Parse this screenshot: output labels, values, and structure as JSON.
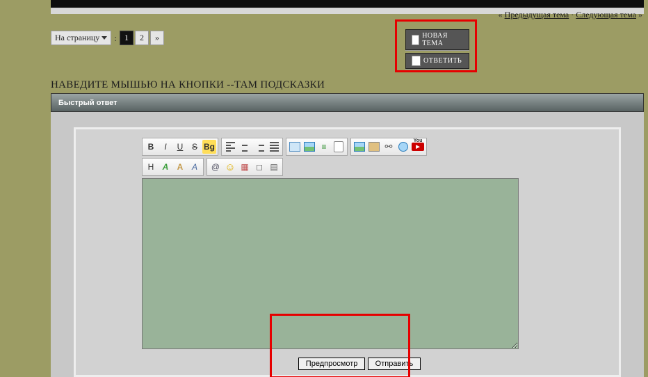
{
  "nav": {
    "prev_prefix": "«",
    "prev_link": "Предыдущая тема",
    "sep": "·",
    "next_link": "Следующая тема",
    "next_suffix": "»"
  },
  "pagination": {
    "label": "На страницу",
    "colon": ":",
    "current": "1",
    "page2": "2",
    "next": "»"
  },
  "actions": {
    "new_topic": "НОВАЯ ТЕМА",
    "reply": "ОТВЕТИТЬ"
  },
  "heading": "НАВЕДИТЕ МЫШЬЮ НА КНОПКИ --ТАМ ПОДСКАЗКИ",
  "quick_reply_title": "Быстрый ответ",
  "toolbar": {
    "bold": "B",
    "italic": "I",
    "underline": "U",
    "strike": "S",
    "bg": "Bg",
    "header": "H",
    "fontA": "A",
    "fontA2": "A",
    "fontA3": "A",
    "at": "@",
    "smiley": "☺",
    "quote_symbol": "❝",
    "link_symbol": "⚯",
    "list_symbol": "≡",
    "doc_symbol": "▤",
    "calendar": "▦",
    "pencil": "✎",
    "hide": "◻",
    "youtube": "You"
  },
  "editor": {
    "value": ""
  },
  "buttons": {
    "preview": "Предпросмотр",
    "submit": "Отправить"
  }
}
